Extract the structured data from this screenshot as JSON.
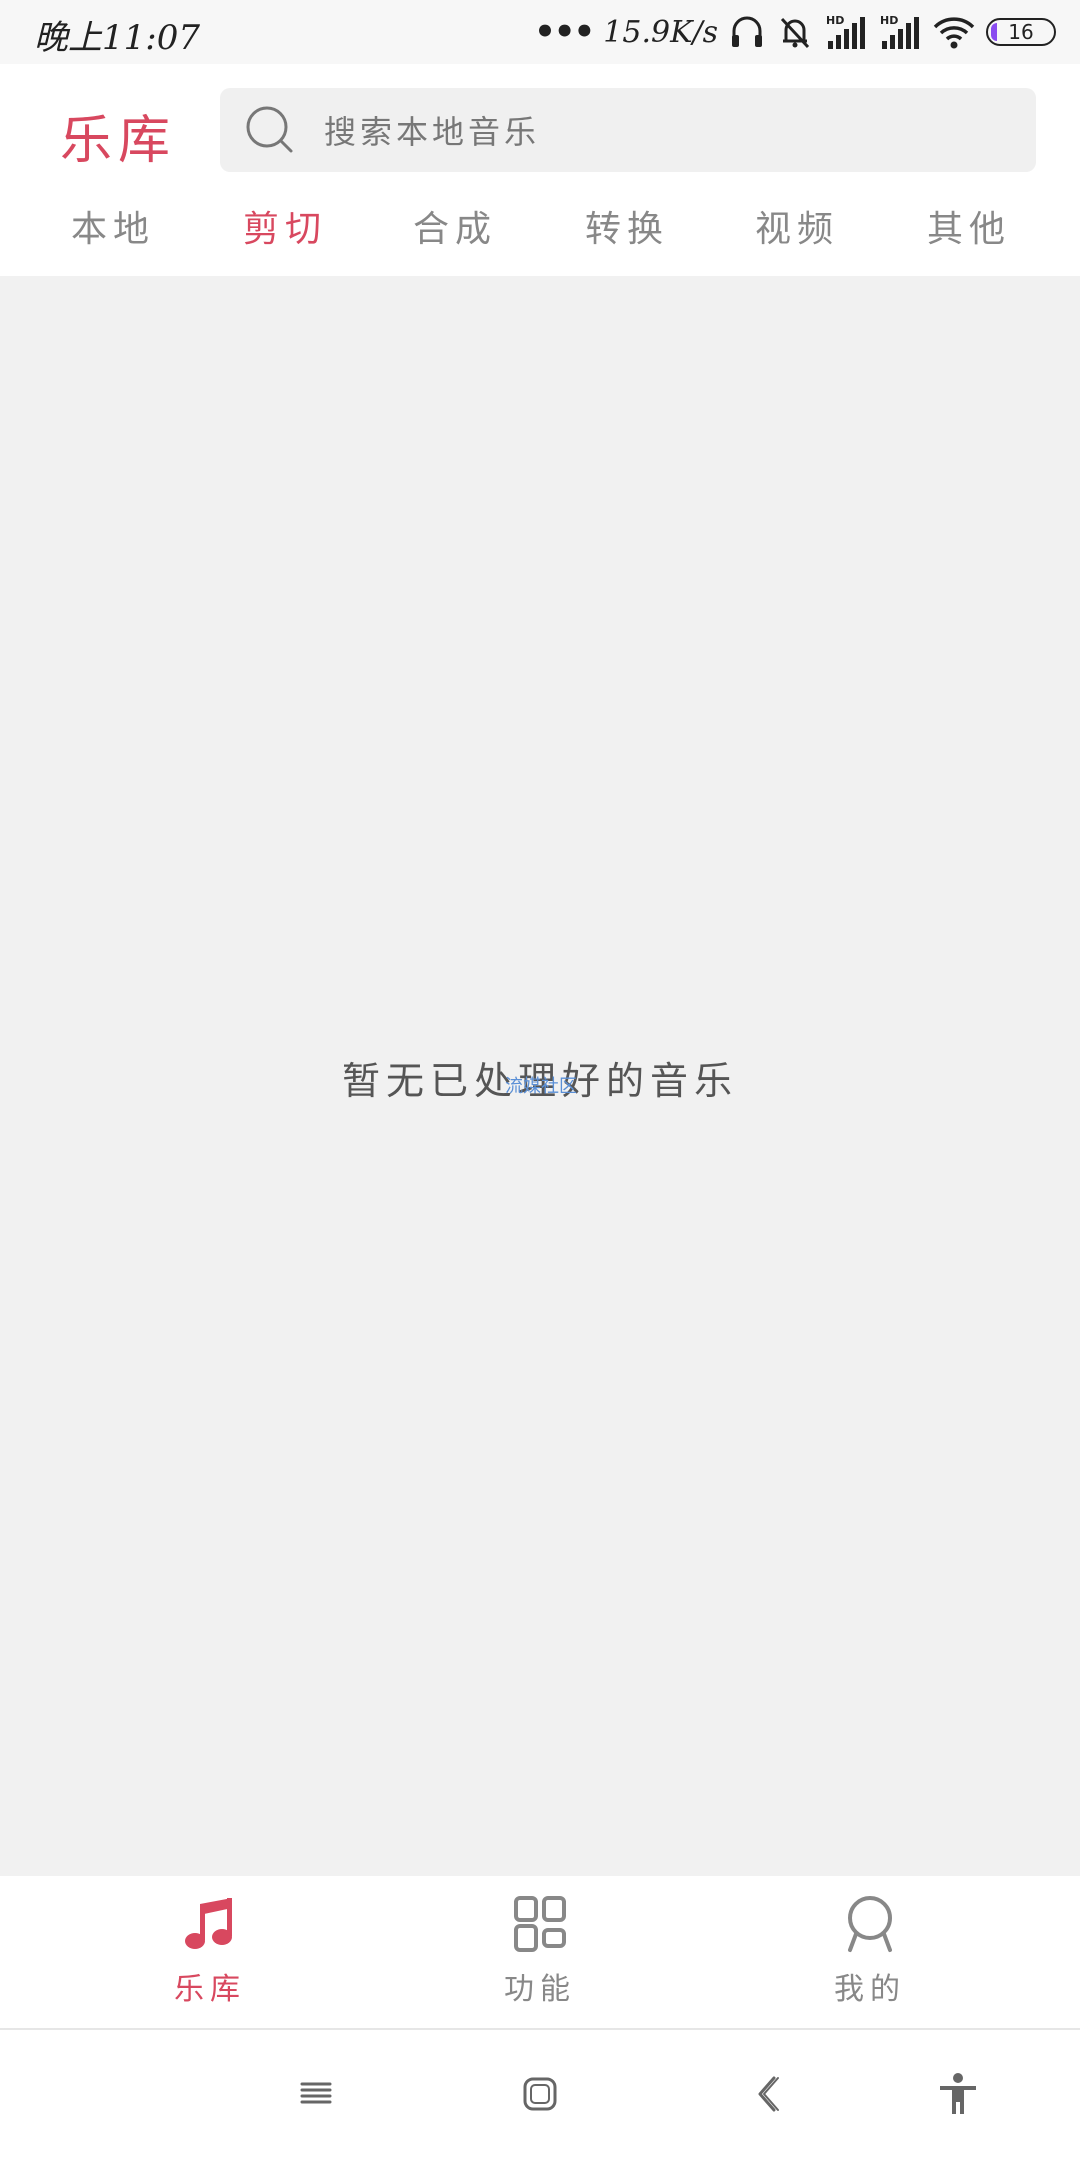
{
  "status_bar": {
    "time": "晚上11:07",
    "network_dots": "•••",
    "network_speed": "15.9K/s",
    "battery_level": "16",
    "icons": [
      "headset-icon",
      "mute-bell-icon",
      "hd-signal-icon",
      "hd-signal-icon",
      "wifi-icon",
      "battery-icon"
    ],
    "battery_fill_color": "#8a4cf0"
  },
  "header": {
    "title": "乐库",
    "search": {
      "placeholder": "搜索本地音乐",
      "icon": "search-icon"
    },
    "tabs": [
      {
        "label": "本地",
        "active": false
      },
      {
        "label": "剪切",
        "active": true
      },
      {
        "label": "合成",
        "active": false
      },
      {
        "label": "转换",
        "active": false
      },
      {
        "label": "视频",
        "active": false
      },
      {
        "label": "其他",
        "active": false
      }
    ]
  },
  "main": {
    "empty_message": "暂无已处理好的音乐",
    "watermark": "流媒社区"
  },
  "bottom_nav": {
    "items": [
      {
        "label": "乐库",
        "icon": "music-note-icon",
        "active": true
      },
      {
        "label": "功能",
        "icon": "grid-icon",
        "active": false
      },
      {
        "label": "我的",
        "icon": "profile-icon",
        "active": false
      }
    ]
  },
  "system_nav": {
    "icons": [
      "menu-icon",
      "home-icon",
      "back-icon",
      "accessibility-icon"
    ]
  },
  "colors": {
    "accent": "#d8485f",
    "inactive": "#888888",
    "background": "#f1f1f1"
  }
}
